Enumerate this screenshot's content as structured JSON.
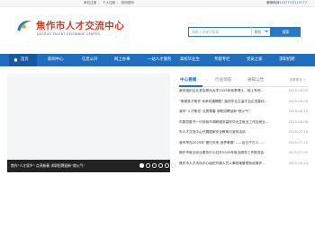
{
  "topbar": {
    "links": [
      "单位注册",
      "个人注册",
      "找回密码"
    ],
    "hotline_label": "服务热线：",
    "hotline": "0391-3119777/2119777"
  },
  "brand": {
    "name_cn": "焦作市人才交流中心",
    "name_en": "JIAOZUO TALENT EXCHANGE CENTER",
    "colors": {
      "primary": "#1f6fbe",
      "logo_red": "#d23a24"
    }
  },
  "search": {
    "placeholder": "请输入关键字搜索",
    "scope": "职位",
    "button": "搜索"
  },
  "nav": {
    "items": [
      "首页",
      "新闻中心",
      "信息公开",
      "网上办事",
      "一站人才服务",
      "高校毕业生",
      "专题专栏",
      "党员之家",
      "求职招聘"
    ],
    "active": "首页"
  },
  "banner": {
    "caption": "焦作“人才家乡” 点亮新春 求职招聘迎新“燃火气”",
    "dot_count": 6,
    "active_dot": 0
  },
  "news": {
    "tabs": [
      "中心要闻",
      "行业动态",
      "通知公告"
    ],
    "active_tab": "中心要闻",
    "more": "查看更多 >",
    "items": [
      {
        "title": "我市组织企业参加郑州大学2025年秋季博士、硕士专场...",
        "date": "2025-09-09"
      },
      {
        "title": "“焦候英才焦作 传承机遇翱翔” 高校毕业生留才百企进高校…",
        "date": "2025-09-06"
      },
      {
        "title": "我市“人才焦作”点亮青春 求职招聘迎新“燃火气”",
        "date": "2025-08-12"
      },
      {
        "title": "市委党委书一行到我市调研服务高校毕业生就业工作及就业...",
        "date": "2025-08-08"
      },
      {
        "title": "市人才交流中心开展国家安全教育日宣传活动",
        "date": "2025-07-16"
      },
      {
        "title": "我市举办2025年“爱归天来 逐梦青春”——启日子万人……",
        "date": "2025-07-11"
      },
      {
        "title": "焦作市就业创业服务中心召开2025年就业服务工作推进会",
        "date": "2025-07-09"
      },
      {
        "title": "焦作市人才流动中心组织开展人员人事档案管理系统操作...",
        "date": "2025-06-24"
      }
    ]
  }
}
